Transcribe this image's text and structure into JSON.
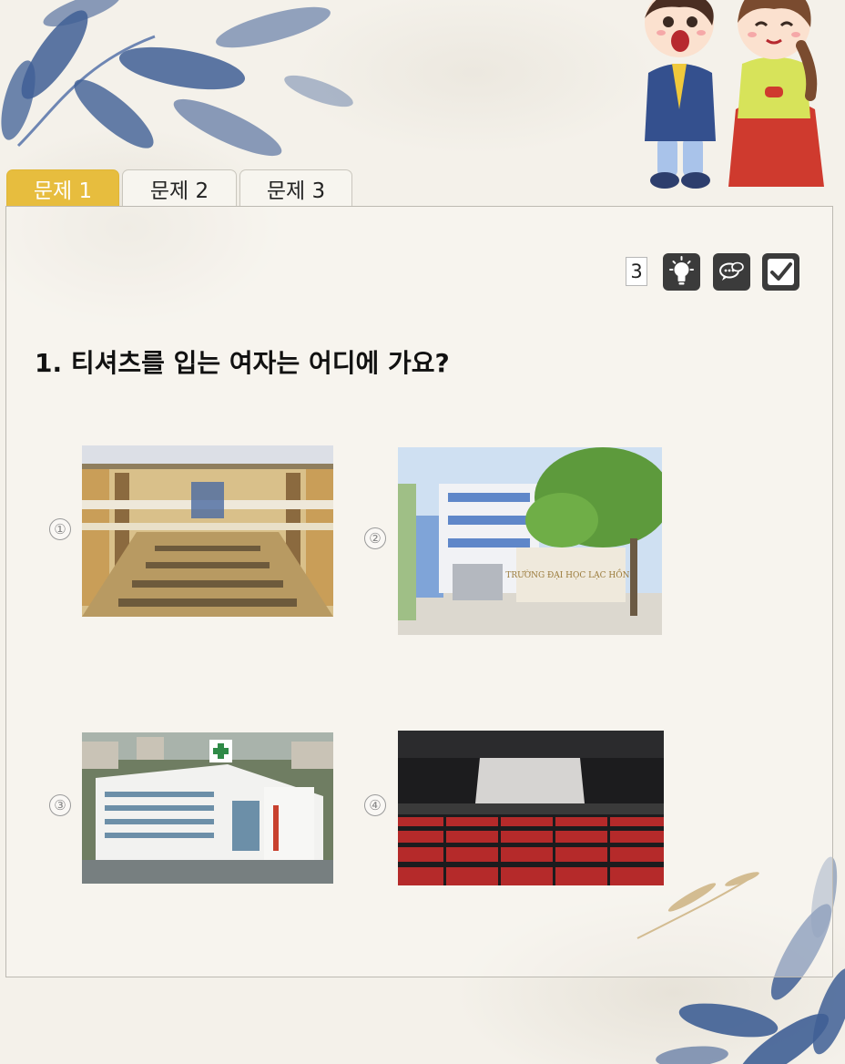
{
  "tabs": [
    {
      "label": "문제 1",
      "active": true
    },
    {
      "label": "문제 2",
      "active": false
    },
    {
      "label": "문제 3",
      "active": false
    }
  ],
  "toolbar": {
    "counter": "3",
    "icons": [
      "lightbulb-icon",
      "chat-bubble-icon",
      "checkmark-icon"
    ]
  },
  "question": {
    "text": "1. 티셔츠를 입는 여자는 어디에 가요?"
  },
  "choices": [
    {
      "number": "1",
      "image": "library-reading-room-photo"
    },
    {
      "number": "2",
      "image": "university-building-photo"
    },
    {
      "number": "3",
      "image": "hospital-building-photo"
    },
    {
      "number": "4",
      "image": "movie-theater-photo"
    }
  ],
  "choice_numbers": {
    "1": "①",
    "2": "②",
    "3": "③",
    "4": "④"
  },
  "photo_text": {
    "university_sign": "TRƯỜNG ĐẠI HỌC LẠC HỒNG"
  },
  "colors": {
    "active_tab": "#e7bd3e",
    "tool_button": "#3b3b3b",
    "background": "#f4f1ea",
    "leaf_blue": "#3f5f95"
  }
}
